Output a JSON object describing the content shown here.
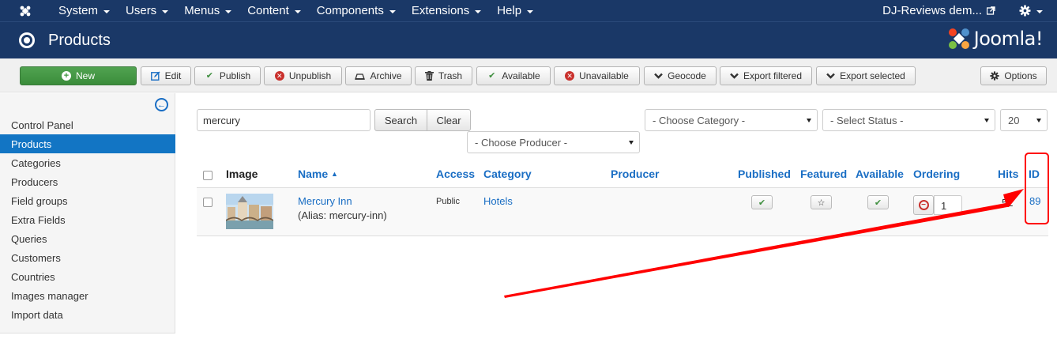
{
  "nav": {
    "menus": [
      "System",
      "Users",
      "Menus",
      "Content",
      "Components",
      "Extensions",
      "Help"
    ],
    "site_name": "DJ-Reviews dem..."
  },
  "title": {
    "page": "Products",
    "brand": "Joomla!"
  },
  "toolbar": {
    "new": "New",
    "edit": "Edit",
    "publish": "Publish",
    "unpublish": "Unpublish",
    "archive": "Archive",
    "trash": "Trash",
    "available": "Available",
    "unavailable": "Unavailable",
    "geocode": "Geocode",
    "export_filtered": "Export filtered",
    "export_selected": "Export selected",
    "options": "Options"
  },
  "sidebar": {
    "items": [
      {
        "label": "Control Panel"
      },
      {
        "label": "Products"
      },
      {
        "label": "Categories"
      },
      {
        "label": "Producers"
      },
      {
        "label": "Field groups"
      },
      {
        "label": "Extra Fields"
      },
      {
        "label": "Queries"
      },
      {
        "label": "Customers"
      },
      {
        "label": "Countries"
      },
      {
        "label": "Images manager"
      },
      {
        "label": "Import data"
      }
    ]
  },
  "filters": {
    "search_value": "mercury",
    "search_button": "Search",
    "clear_button": "Clear",
    "category": "- Choose Category -",
    "status": "- Select Status -",
    "limit": "20",
    "producer": "- Choose Producer -"
  },
  "table": {
    "headers": {
      "image": "Image",
      "name": "Name",
      "access": "Access",
      "category": "Category",
      "producer": "Producer",
      "published": "Published",
      "featured": "Featured",
      "available": "Available",
      "ordering": "Ordering",
      "hits": "Hits",
      "id": "ID"
    },
    "rows": [
      {
        "name": "Mercury Inn",
        "alias": "(Alias: mercury-inn)",
        "access": "Public",
        "category": "Hotels",
        "producer": "",
        "ordering": "1",
        "hits": "52",
        "id": "89"
      }
    ]
  },
  "colors": {
    "navbar": "#1a3867",
    "active": "#1275c4",
    "link": "#1a6ec4",
    "annotation": "#ff0000"
  }
}
